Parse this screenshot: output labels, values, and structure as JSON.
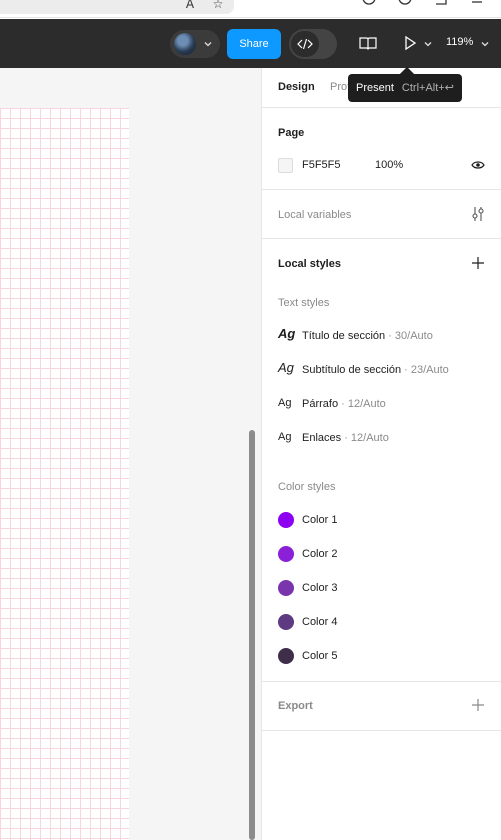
{
  "browser": {
    "icons": [
      "translate-icon",
      "bookmark-star-icon",
      "download-icon",
      "profile-icon",
      "extensions-icon",
      "menu-icon"
    ]
  },
  "toolbar": {
    "share_label": "Share",
    "zoom_label": "119%"
  },
  "tooltip": {
    "label": "Present",
    "shortcut": "Ctrl+Alt+↩"
  },
  "panel": {
    "tabs": [
      {
        "label": "Design",
        "active": true
      },
      {
        "label": "Prototype",
        "active": false
      }
    ],
    "page": {
      "title": "Page",
      "color_hex": "F5F5F5",
      "opacity": "100%"
    },
    "local_variables": {
      "title": "Local variables"
    },
    "local_styles": {
      "title": "Local styles"
    },
    "text_styles": {
      "title": "Text styles",
      "items": [
        {
          "glyph": "Ag",
          "name": "Título de sección",
          "meta": " · 30/Auto"
        },
        {
          "glyph": "Ag",
          "name": "Subtítulo de sección",
          "meta": " · 23/Auto"
        },
        {
          "glyph": "Ag",
          "name": "Párrafo",
          "meta": " · 12/Auto"
        },
        {
          "glyph": "Ag",
          "name": "Enlaces",
          "meta": " · 12/Auto"
        }
      ]
    },
    "color_styles": {
      "title": "Color styles",
      "items": [
        {
          "name": "Color 1",
          "color": "#8e00f0"
        },
        {
          "name": "Color 2",
          "color": "#8a20d8"
        },
        {
          "name": "Color 3",
          "color": "#7a35ad"
        },
        {
          "name": "Color 4",
          "color": "#5e3a82"
        },
        {
          "name": "Color 5",
          "color": "#3f2e4a"
        }
      ]
    },
    "export": {
      "title": "Export"
    }
  },
  "colors": {
    "toolbar_bg": "#2c2c2c",
    "accent": "#0d99ff",
    "grid_line": "#f6d6dc"
  }
}
